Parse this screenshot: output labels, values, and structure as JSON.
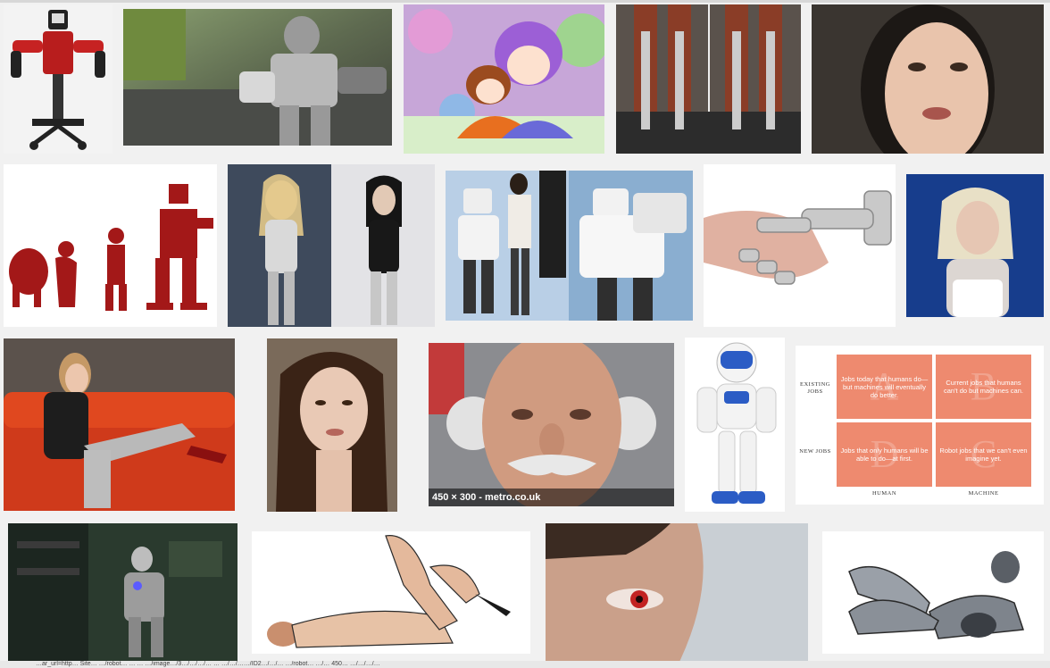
{
  "results": [
    {
      "id": "r1",
      "alt": "red industrial robot"
    },
    {
      "id": "r2",
      "alt": "humanoid robot kit"
    },
    {
      "id": "r3",
      "alt": "anime couple illustration"
    },
    {
      "id": "r4",
      "alt": "exoskeleton legs on treadmill"
    },
    {
      "id": "r5",
      "alt": "android woman face"
    },
    {
      "id": "r6",
      "alt": "evolution to robot silhouette"
    },
    {
      "id": "r7",
      "alt": "cyborg women collage"
    },
    {
      "id": "r8",
      "alt": "robots with engineer"
    },
    {
      "id": "r9",
      "alt": "robot and human handshake"
    },
    {
      "id": "r10",
      "alt": "cyborg woman portrait"
    },
    {
      "id": "r11",
      "alt": "cyborg on orange sofa"
    },
    {
      "id": "r12",
      "alt": "android woman with dark hair"
    },
    {
      "id": "r13",
      "alt": "elderly man face"
    },
    {
      "id": "r14",
      "alt": "small white and blue robot"
    },
    {
      "id": "r15",
      "alt": "jobs matrix chart"
    },
    {
      "id": "r16",
      "alt": "robot in workshop"
    },
    {
      "id": "r17",
      "alt": "reclining cyborg woman"
    },
    {
      "id": "r18",
      "alt": "man with red robotic eye"
    },
    {
      "id": "r19",
      "alt": "reclining chrome robot"
    }
  ],
  "hover_label": "450 × 300 - metro.co.uk",
  "jobs_chart": {
    "rows": [
      "EXISTING JOBS",
      "NEW JOBS"
    ],
    "cols": [
      "HUMAN",
      "MACHINE"
    ],
    "cells": [
      {
        "letter": "A",
        "text": "Jobs today that humans do—but machines will eventually do better."
      },
      {
        "letter": "B",
        "text": "Current jobs that humans can't do but machines can."
      },
      {
        "letter": "D",
        "text": "Jobs that only humans will be able to do—at first."
      },
      {
        "letter": "C",
        "text": "Robot jobs that we can't even imagine yet."
      }
    ]
  },
  "colors": {
    "page_bg": "#f1f1f1",
    "chart_orange": "#ee8a6f",
    "evolution_red": "#a31818"
  },
  "status_bar_text": "…ar_url=http… Site… …/robot… … … …/image…/3…/…/…/… … …/…/……/ID2…/…/… …/robot… …/… 450… …/…/…/…"
}
